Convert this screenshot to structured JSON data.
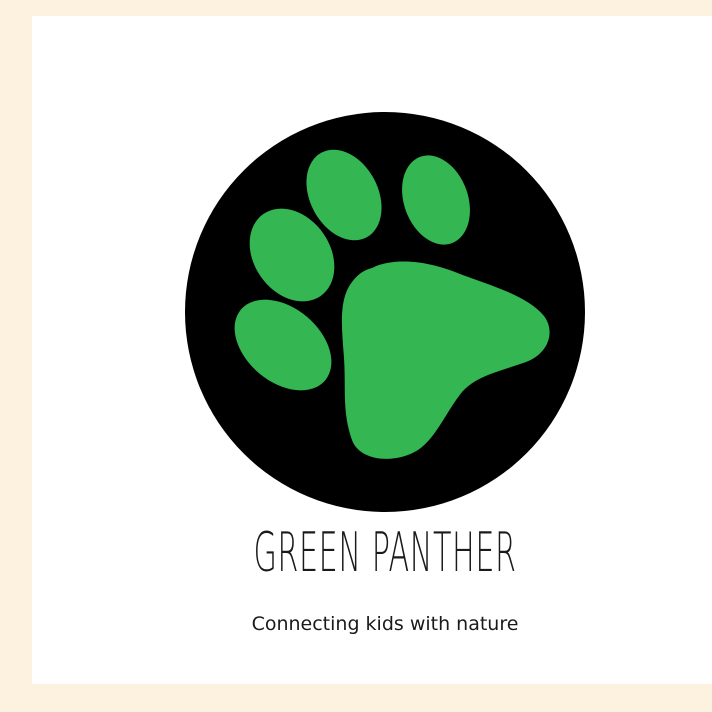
{
  "brand": {
    "name": "GREEN PANTHER",
    "tagline": "Connecting kids with nature"
  },
  "logo": {
    "icon": "paw-print-icon",
    "circle_color": "#000000",
    "paw_color": "#34B653"
  },
  "colors": {
    "page_background": "#FDF1DF",
    "card_background": "#FFFFFF",
    "text": "#1A1A1A"
  }
}
